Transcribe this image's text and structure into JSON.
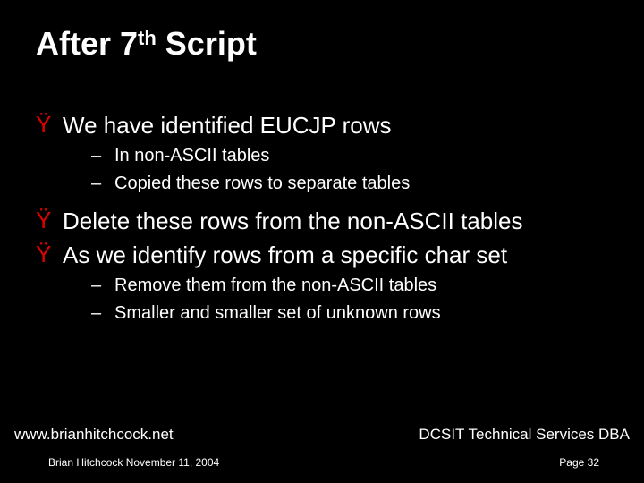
{
  "title_pre": "After 7",
  "title_sup": "th",
  "title_post": " Script",
  "bullets": [
    {
      "level": 1,
      "text": "We have identified EUCJP rows"
    },
    {
      "level": 2,
      "text": "In non-ASCII tables"
    },
    {
      "level": 2,
      "text": "Copied these rows to separate tables"
    },
    {
      "level": 1,
      "text": "Delete these rows from the non-ASCII tables"
    },
    {
      "level": 1,
      "text": "As we identify rows from a specific char set"
    },
    {
      "level": 2,
      "text": "Remove them from the non-ASCII tables"
    },
    {
      "level": 2,
      "text": "Smaller and smaller set of unknown rows"
    }
  ],
  "bullet_glyph_l1": "Ÿ",
  "bullet_glyph_l2": "–",
  "footer": {
    "url": "www.brianhitchcock.net",
    "author_date": "Brian Hitchcock   November 11, 2004",
    "org": "DCSIT Technical Services DBA",
    "page": "Page 32"
  }
}
